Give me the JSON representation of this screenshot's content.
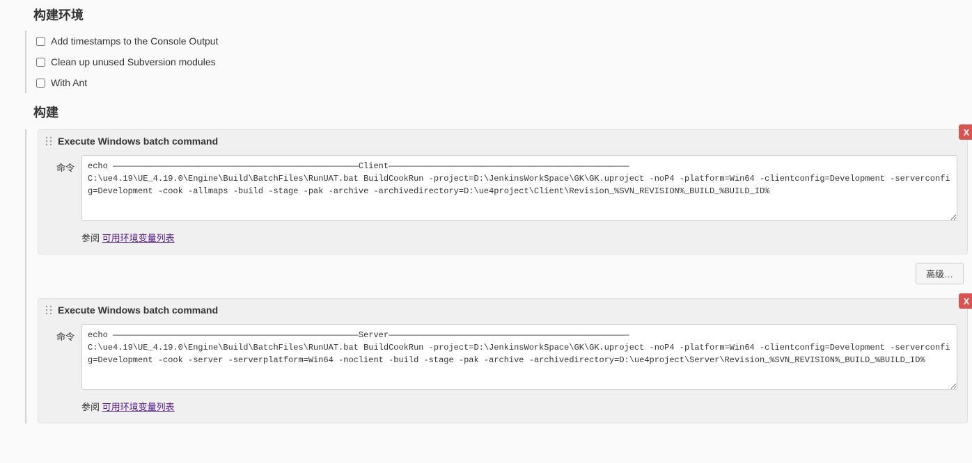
{
  "sections": {
    "build_env_title": "构建环境",
    "build_title": "构建"
  },
  "env_checkboxes": [
    {
      "label": "Add timestamps to the Console Output",
      "checked": false
    },
    {
      "label": "Clean up unused Subversion modules",
      "checked": false
    },
    {
      "label": "With Ant",
      "checked": false
    }
  ],
  "build_steps": [
    {
      "title": "Execute Windows batch command",
      "command_label": "命令",
      "command_value": "echo —————————————————————————————————————————————————Client————————————————————————————————————————————————\nC:\\ue4.19\\UE_4.19.0\\Engine\\Build\\BatchFiles\\RunUAT.bat BuildCookRun -project=D:\\JenkinsWorkSpace\\GK\\GK.uproject -noP4 -platform=Win64 -clientconfig=Development -serverconfig=Development -cook -allmaps -build -stage -pak -archive -archivedirectory=D:\\ue4project\\Client\\Revision_%SVN_REVISION%_BUILD_%BUILD_ID%",
      "help_prefix": "参阅 ",
      "help_link": "可用环境变量列表",
      "delete_label": "X",
      "advanced_label": "高级…"
    },
    {
      "title": "Execute Windows batch command",
      "command_label": "命令",
      "command_value": "echo —————————————————————————————————————————————————Server————————————————————————————————————————————————\nC:\\ue4.19\\UE_4.19.0\\Engine\\Build\\BatchFiles\\RunUAT.bat BuildCookRun -project=D:\\JenkinsWorkSpace\\GK\\GK.uproject -noP4 -platform=Win64 -clientconfig=Development -serverconfig=Development -cook -server -serverplatform=Win64 -noclient -build -stage -pak -archive -archivedirectory=D:\\ue4project\\Server\\Revision_%SVN_REVISION%_BUILD_%BUILD_ID%",
      "help_prefix": "参阅 ",
      "help_link": "可用环境变量列表",
      "delete_label": "X"
    }
  ]
}
